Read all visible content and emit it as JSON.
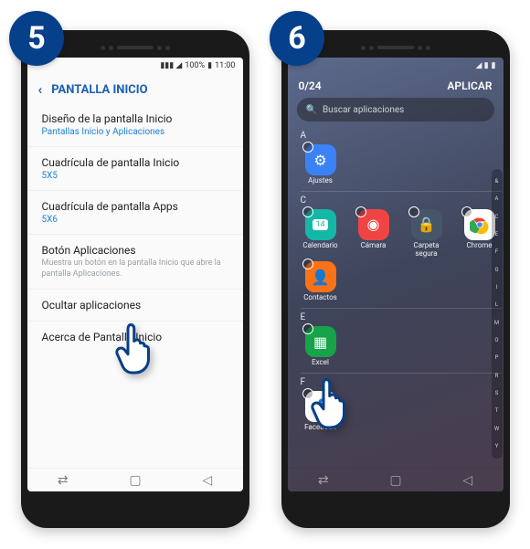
{
  "steps": {
    "five": "5",
    "six": "6"
  },
  "status": {
    "sig": "▲▌▎",
    "batt": "100%",
    "clock": "11:00"
  },
  "left": {
    "header": "PANTALLA INICIO",
    "items": [
      {
        "title": "Diseño de la pantalla Inicio",
        "sub": "Pantallas Inicio y Aplicaciones",
        "desc": ""
      },
      {
        "title": "Cuadrícula de pantalla Inicio",
        "sub": "5X5",
        "desc": ""
      },
      {
        "title": "Cuadrícula de pantalla Apps",
        "sub": "5X6",
        "desc": ""
      },
      {
        "title": "Botón Aplicaciones",
        "sub": "",
        "desc": "Muestra un botón en la pantalla Inicio que abre la pantalla Aplicaciones."
      },
      {
        "title": "Ocultar aplicaciones",
        "sub": "",
        "desc": ""
      },
      {
        "title": "Acerca de Pantalla Inicio",
        "sub": "",
        "desc": ""
      }
    ]
  },
  "right": {
    "counter": "0/24",
    "apply": "APLICAR",
    "search_placeholder": "Buscar aplicaciones",
    "sections": {
      "A": [
        {
          "name": "Ajustes"
        }
      ],
      "C": [
        {
          "name": "Calendario"
        },
        {
          "name": "Cámara"
        },
        {
          "name": "Carpeta segura"
        },
        {
          "name": "Chrome"
        },
        {
          "name": "Contactos"
        }
      ],
      "E": [
        {
          "name": "Excel"
        }
      ],
      "F": [
        {
          "name": "Facebook"
        }
      ]
    },
    "alpha": [
      "&",
      "A",
      "C",
      "E",
      "F",
      "G",
      "I",
      "L",
      "M",
      "O",
      "P",
      "R",
      "S",
      "T",
      "W",
      "Y"
    ]
  }
}
